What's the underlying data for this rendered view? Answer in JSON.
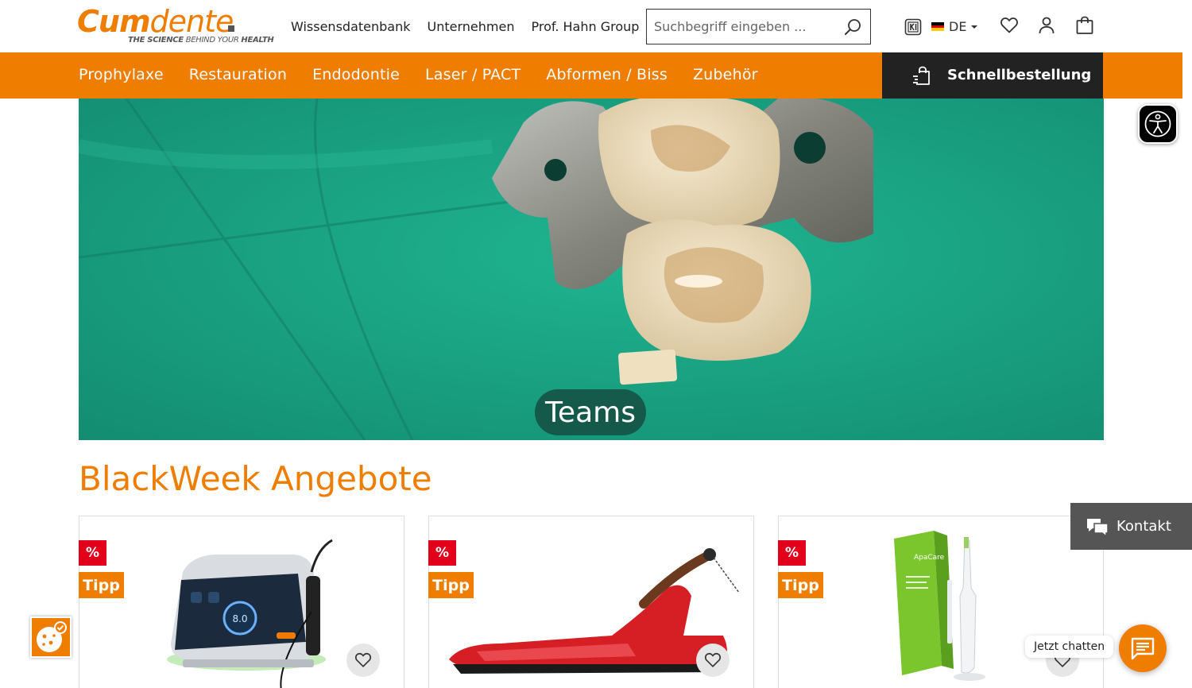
{
  "header": {
    "logo": {
      "brand_bold": "Cum",
      "brand_light": "dente",
      "tagline_bold": "THE SCIENCE",
      "tagline_light": " BEHIND YOUR ",
      "tagline_bold2": "HEALTH"
    },
    "top_links": [
      "Wissensdatenbank",
      "Unternehmen",
      "Prof. Hahn Group"
    ],
    "search": {
      "placeholder": "Suchbegriff eingeben ..."
    },
    "language": {
      "code": "DE",
      "flag_colors": [
        "#000000",
        "#dd0000",
        "#ffce00"
      ]
    },
    "icons": [
      "ki-icon",
      "heart-icon",
      "user-icon",
      "shopping-bag-icon"
    ]
  },
  "main_nav": {
    "items": [
      "Prophylaxe",
      "Restauration",
      "Endodontie",
      "Laser / PACT",
      "Abformen / Biss",
      "Zubehör"
    ],
    "quick_order_label": "Schnellbestellung"
  },
  "hero": {
    "badge": "Teams"
  },
  "section": {
    "title": "BlackWeek Angebote"
  },
  "products": [
    {
      "badge_sale": "%",
      "badge_tip": "Tipp",
      "image": "laser-device"
    },
    {
      "badge_sale": "%",
      "badge_tip": "Tipp",
      "image": "red-handpiece"
    },
    {
      "badge_sale": "%",
      "badge_tip": "Tipp",
      "image": "apacare-toothbrush",
      "box_text": "ApaCare"
    }
  ],
  "floating": {
    "contact_label": "Kontakt",
    "chat_label": "Jetzt chatten"
  },
  "colors": {
    "brand_orange": "#ef7d00",
    "sale_red": "#e2001a",
    "dark": "#222222"
  }
}
